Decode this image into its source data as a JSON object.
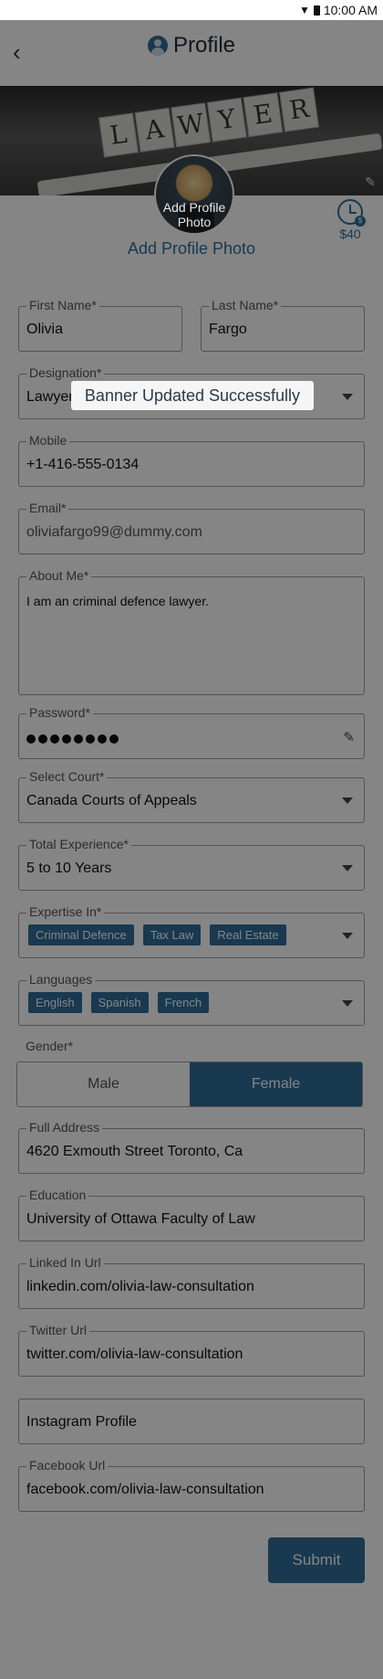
{
  "status_bar": {
    "time": "10:00 AM"
  },
  "header": {
    "title": "Profile"
  },
  "banner": {
    "tile_letters": [
      "L",
      "A",
      "W",
      "Y",
      "E",
      "R"
    ],
    "avatar_overlay_text": "Add Profile Photo"
  },
  "credit": {
    "amount": "$40"
  },
  "add_photo_label": "Add Profile Photo",
  "toast": {
    "message": "Banner Updated Successfully"
  },
  "form": {
    "first_name": {
      "label": "First Name*",
      "value": "Olivia"
    },
    "last_name": {
      "label": "Last Name*",
      "value": "Fargo"
    },
    "designation": {
      "label": "Designation*",
      "value": "Lawyer"
    },
    "mobile": {
      "label": "Mobile",
      "value": "+1-416-555-0134"
    },
    "email": {
      "label": "Email*",
      "value": "oliviafargo99@dummy.com"
    },
    "about_me": {
      "label": "About Me*",
      "value": "I am an criminal defence lawyer."
    },
    "password": {
      "label": "Password*",
      "dot_count": 8
    },
    "court": {
      "label": "Select Court*",
      "value": "Canada Courts of Appeals"
    },
    "experience": {
      "label": "Total Experience*",
      "value": "5 to 10 Years"
    },
    "expertise": {
      "label": "Expertise In*",
      "chips": [
        "Criminal Defence",
        "Tax Law",
        "Real Estate"
      ]
    },
    "languages": {
      "label": "Languages",
      "chips": [
        "English",
        "Spanish",
        "French"
      ]
    },
    "gender": {
      "label": "Gender*",
      "options": [
        "Male",
        "Female"
      ],
      "selected": "Female"
    },
    "address": {
      "label": "Full Address",
      "value": "4620  Exmouth Street Toronto, Ca"
    },
    "education": {
      "label": "Education",
      "value": "University of Ottawa Faculty of Law"
    },
    "linkedin": {
      "label": "Linked In Url",
      "value": "linkedin.com/olivia-law-consultation"
    },
    "twitter": {
      "label": "Twitter Url",
      "value": "twitter.com/olivia-law-consultation"
    },
    "instagram": {
      "placeholder": "Instagram Profile"
    },
    "facebook": {
      "label": "Facebook Url",
      "value": "facebook.com/olivia-law-consultation"
    }
  },
  "submit_label": "Submit",
  "colors": {
    "accent": "#2e6e99",
    "overlay": "rgba(0,0,0,0.48)"
  }
}
